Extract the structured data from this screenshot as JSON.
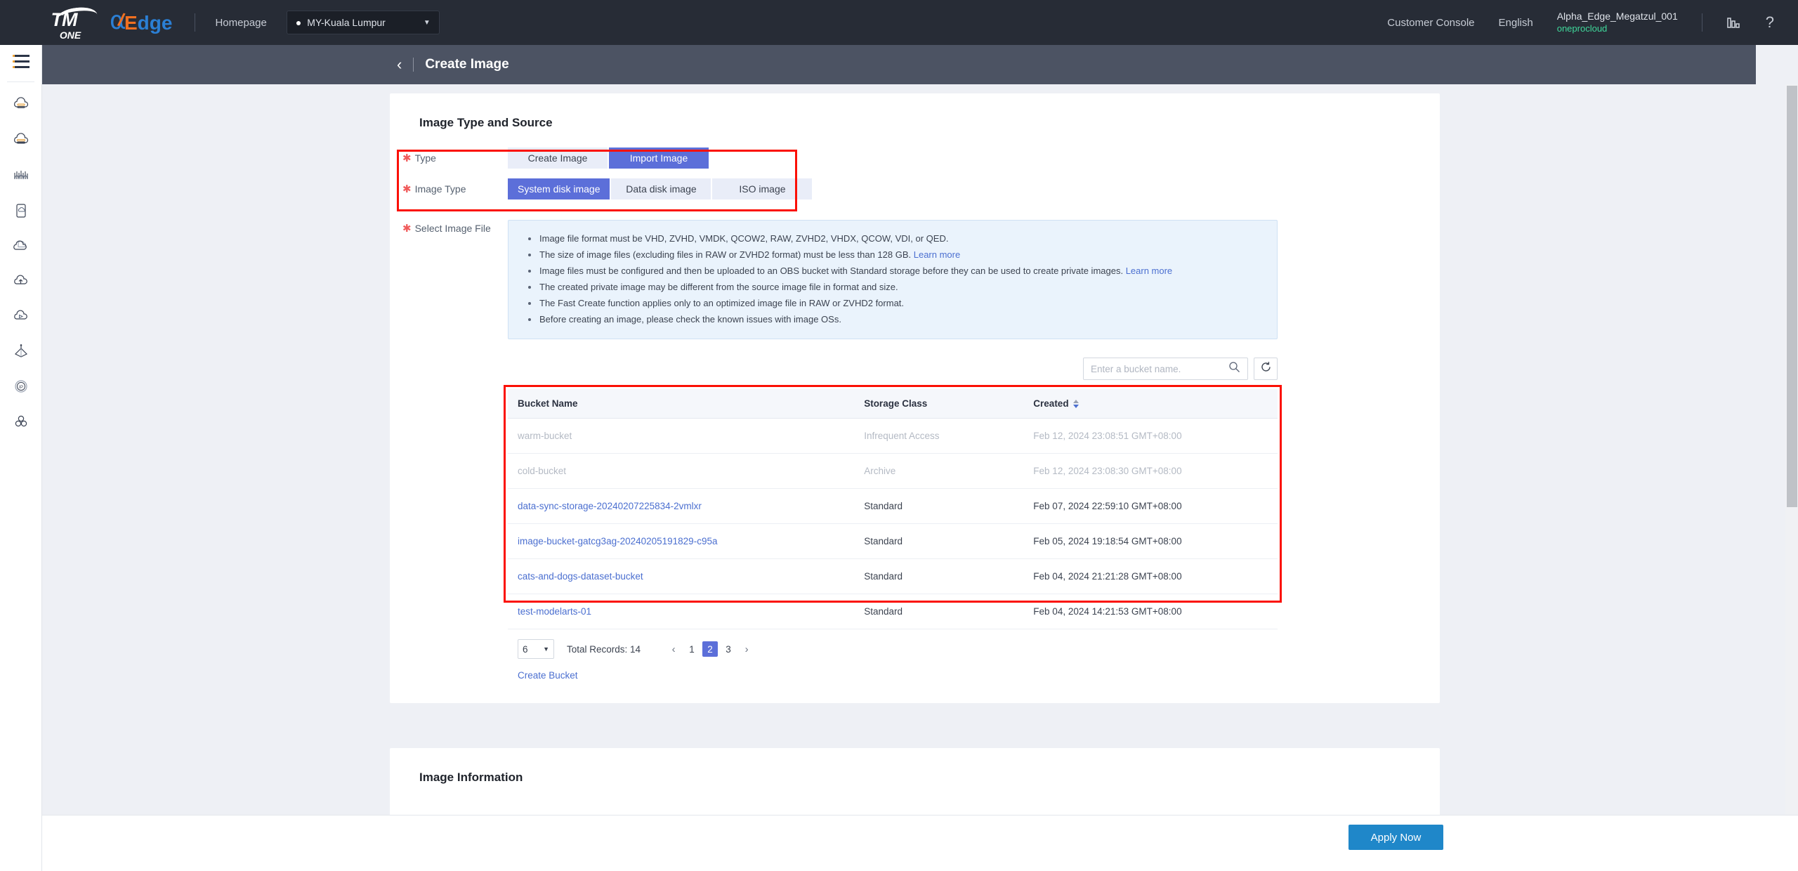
{
  "header": {
    "logo_tm": "TM",
    "logo_one": "ONE",
    "logo_edge": "dge",
    "logo_edge_e": "E",
    "homepage_label": "Homepage",
    "region": "MY-Kuala Lumpur",
    "region_icon": "location-pin-icon",
    "customer_console": "Customer Console",
    "language": "English",
    "user_name": "Alpha_Edge_Megatzul_001",
    "user_org": "oneprocloud",
    "metrics_icon": "bar-chart-icon",
    "help_icon": "question-mark-icon"
  },
  "sidebar": {
    "menu_icon": "hamburger-menu-icon",
    "items": [
      {
        "icon": "cloud-server-icon"
      },
      {
        "icon": "cloud-database-icon"
      },
      {
        "icon": "network-waves-icon"
      },
      {
        "icon": "mobile-cloud-icon"
      },
      {
        "icon": "cloud-stack-icon"
      },
      {
        "icon": "cloud-upload-icon"
      },
      {
        "icon": "cloud-play-icon"
      },
      {
        "icon": "cdn-pyramid-icon"
      },
      {
        "icon": "ip-address-icon"
      },
      {
        "icon": "cluster-nodes-icon"
      }
    ]
  },
  "pagebar": {
    "back_icon": "chevron-left-icon",
    "title": "Create Image"
  },
  "main": {
    "section_title": "Image Type and Source",
    "type_label": "Type",
    "type_options": [
      "Create Image",
      "Import Image"
    ],
    "type_selected": "Import Image",
    "image_type_label": "Image Type",
    "image_type_options": [
      "System disk image",
      "Data disk image",
      "ISO image"
    ],
    "image_type_selected": "System disk image",
    "select_file_label": "Select Image File",
    "info_bullets": [
      "Image file format must be VHD, ZVHD, VMDK, QCOW2, RAW, ZVHD2, VHDX, QCOW, VDI, or QED.",
      "The size of image files (excluding files in RAW or ZVHD2 format) must be less than 128 GB. ",
      "Image files must be configured and then be uploaded to an OBS bucket with Standard storage before they can be used to create private images. ",
      "The created private image may be different from the source image file in format and size.",
      "The Fast Create function applies only to an optimized image file in RAW or ZVHD2 format.",
      "Before creating an image, please check the known issues with image OSs."
    ],
    "learn_more": "Learn more",
    "search_placeholder": "Enter a bucket name.",
    "search_value": "",
    "search_icon": "search-icon",
    "refresh_icon": "refresh-icon",
    "table": {
      "columns": [
        "Bucket Name",
        "Storage Class",
        "Created"
      ],
      "sort_column": "Created",
      "rows": [
        {
          "name": "warm-bucket",
          "storage": "Infrequent Access",
          "created": "Feb 12, 2024 23:08:51 GMT+08:00",
          "disabled": true
        },
        {
          "name": "cold-bucket",
          "storage": "Archive",
          "created": "Feb 12, 2024 23:08:30 GMT+08:00",
          "disabled": true
        },
        {
          "name": "data-sync-storage-20240207225834-2vmlxr",
          "storage": "Standard",
          "created": "Feb 07, 2024 22:59:10 GMT+08:00",
          "disabled": false
        },
        {
          "name": "image-bucket-gatcg3ag-20240205191829-c95a",
          "storage": "Standard",
          "created": "Feb 05, 2024 19:18:54 GMT+08:00",
          "disabled": false
        },
        {
          "name": "cats-and-dogs-dataset-bucket",
          "storage": "Standard",
          "created": "Feb 04, 2024 21:21:28 GMT+08:00",
          "disabled": false
        },
        {
          "name": "test-modelarts-01",
          "storage": "Standard",
          "created": "Feb 04, 2024 14:21:53 GMT+08:00",
          "disabled": false
        }
      ]
    },
    "pagination": {
      "page_size": "6",
      "total_records": "Total Records: 14",
      "prev_icon": "chevron-left-icon",
      "next_icon": "chevron-right-icon",
      "pages": [
        "1",
        "2",
        "3"
      ],
      "active_page": "2"
    },
    "create_bucket_link": "Create Bucket",
    "image_information_title": "Image Information"
  },
  "footer": {
    "apply_label": "Apply Now"
  },
  "colors": {
    "accent_blue": "#5c6fd9",
    "apply_blue": "#1f87c9",
    "link_blue": "#4b6fd0",
    "annotation_red": "#fb1005",
    "header_dark": "#272c36",
    "pagebar_gray": "#4c5363",
    "org_green": "#3fd89b",
    "required_star": "#f05b5b"
  }
}
